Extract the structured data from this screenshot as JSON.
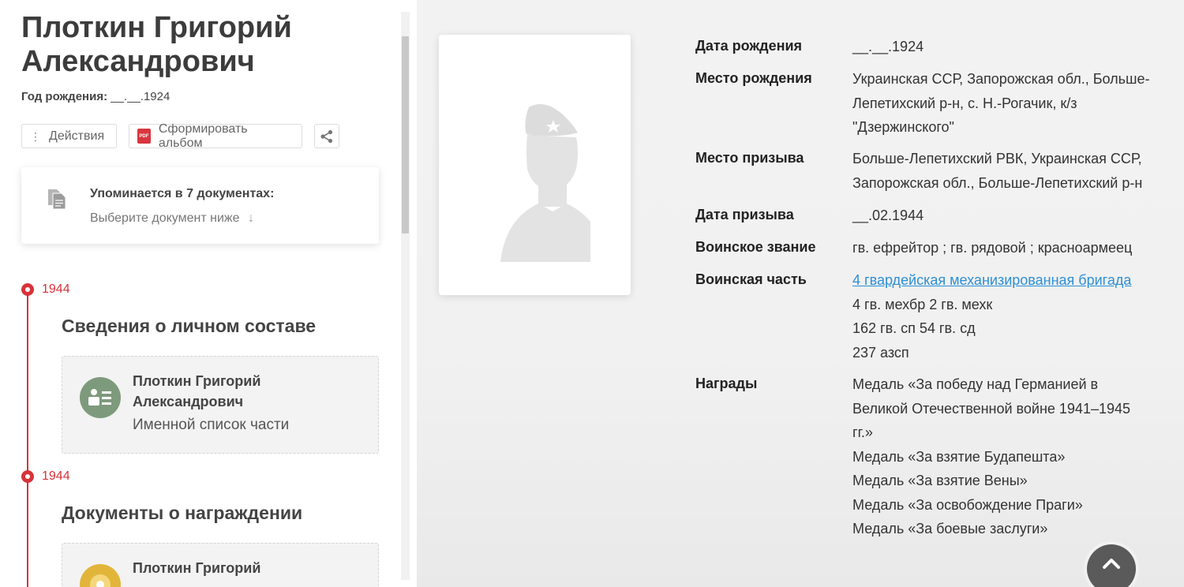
{
  "person": {
    "name": "Плоткин Григорий Александрович",
    "birth_year_label": "Год рождения:",
    "birth_year_value": "__.__.1924"
  },
  "actions": {
    "actions_label": "Действия",
    "album_label": "Сформировать альбом",
    "pdf_badge": "PDF"
  },
  "mentions": {
    "title": "Упоминается в 7 документах:",
    "subtitle": "Выберите документ ниже",
    "arrow": "↓"
  },
  "timeline": [
    {
      "year": "1944",
      "section": "Сведения о личном составе",
      "card": {
        "name": [
          "Плоткин Григорий",
          "Александрович"
        ],
        "type": "Именной список части",
        "icon": "personnel-list-icon"
      }
    },
    {
      "year": "1944",
      "section": "Документы о награждении",
      "card": {
        "name": [
          "Плоткин Григорий"
        ],
        "icon": "award-medal-icon"
      }
    }
  ],
  "info": [
    {
      "label": "Дата рождения",
      "values": [
        "__.__.1924"
      ]
    },
    {
      "label": "Место рождения",
      "values": [
        "Украинская ССР, Запорожская обл., Больше-",
        "Лепетихский р-н, с. Н.-Рогачик, к/з",
        "\"Дзержинского\""
      ]
    },
    {
      "label": "Место призыва",
      "values": [
        "Больше-Лепетихский РВК, Украинская ССР,",
        "Запорожская обл., Больше-Лепетихский р-н"
      ]
    },
    {
      "label": "Дата призыва",
      "values": [
        "__.02.1944"
      ]
    },
    {
      "label": "Воинское звание",
      "values": [
        "гв. ефрейтор ; гв. рядовой ; красноармеец"
      ]
    },
    {
      "label": "Воинская часть",
      "link": "4 гвардейская механизированная бригада",
      "values": [
        "4 гв. мехбр 2 гв. мехк",
        "162 гв. сп 54 гв. сд",
        "237 азсп"
      ]
    },
    {
      "label": "Награды",
      "values": [
        "Медаль «За победу над Германией в",
        "Великой Отечественной войне 1941–1945",
        "гг.»",
        "Медаль «За взятие Будапешта»",
        "Медаль «За взятие Вены»",
        "Медаль «За освобождение Праги»",
        "Медаль «За боевые заслуги»"
      ]
    }
  ],
  "colors": {
    "accent_red": "#d8323a",
    "link_blue": "#2d8fd5",
    "personnel_icon_green": "#7e9a7c",
    "award_icon_gold": "#e2b53a"
  }
}
